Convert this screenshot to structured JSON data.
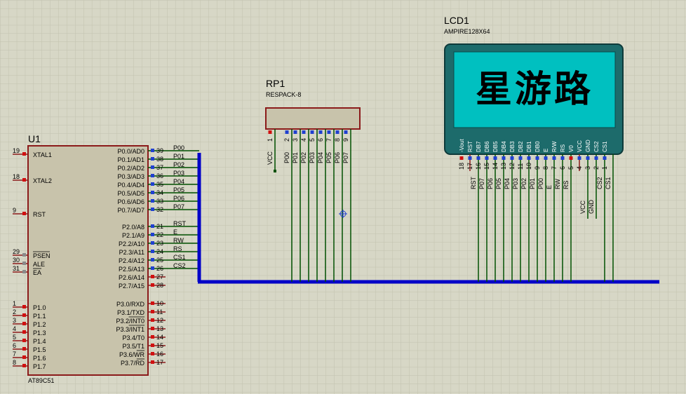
{
  "u1": {
    "ref": "U1",
    "part": "AT89C51",
    "left_pins": [
      {
        "num": "19",
        "name": "XTAL1"
      },
      {
        "num": "18",
        "name": "XTAL2"
      },
      {
        "num": "9",
        "name": "RST"
      },
      {
        "num": "29",
        "name": "PSEN"
      },
      {
        "num": "30",
        "name": "ALE"
      },
      {
        "num": "31",
        "name": "EA"
      },
      {
        "num": "1",
        "name": "P1.0"
      },
      {
        "num": "2",
        "name": "P1.1"
      },
      {
        "num": "3",
        "name": "P1.2"
      },
      {
        "num": "4",
        "name": "P1.3"
      },
      {
        "num": "5",
        "name": "P1.4"
      },
      {
        "num": "6",
        "name": "P1.5"
      },
      {
        "num": "7",
        "name": "P1.6"
      },
      {
        "num": "8",
        "name": "P1.7"
      }
    ],
    "right_pins": [
      {
        "num": "39",
        "name": "P0.0/AD0",
        "net": "P00"
      },
      {
        "num": "38",
        "name": "P0.1/AD1",
        "net": "P01"
      },
      {
        "num": "37",
        "name": "P0.2/AD2",
        "net": "P02"
      },
      {
        "num": "36",
        "name": "P0.3/AD3",
        "net": "P03"
      },
      {
        "num": "35",
        "name": "P0.4/AD4",
        "net": "P04"
      },
      {
        "num": "34",
        "name": "P0.5/AD5",
        "net": "P05"
      },
      {
        "num": "33",
        "name": "P0.6/AD6",
        "net": "P06"
      },
      {
        "num": "32",
        "name": "P0.7/AD7",
        "net": "P07"
      },
      {
        "num": "21",
        "name": "P2.0/A8",
        "net": "RST"
      },
      {
        "num": "22",
        "name": "P2.1/A9",
        "net": "E"
      },
      {
        "num": "23",
        "name": "P2.2/A10",
        "net": "RW"
      },
      {
        "num": "24",
        "name": "P2.3/A11",
        "net": "RS"
      },
      {
        "num": "25",
        "name": "P2.4/A12",
        "net": "CS1"
      },
      {
        "num": "26",
        "name": "P2.5/A13",
        "net": "CS2"
      },
      {
        "num": "27",
        "name": "P2.6/A14",
        "net": ""
      },
      {
        "num": "28",
        "name": "P2.7/A15",
        "net": ""
      },
      {
        "num": "10",
        "name": "P3.0/RXD",
        "net": ""
      },
      {
        "num": "11",
        "name": "P3.1/TXD",
        "net": ""
      },
      {
        "num": "12",
        "name": "P3.2/INT0",
        "net": ""
      },
      {
        "num": "13",
        "name": "P3.3/INT1",
        "net": ""
      },
      {
        "num": "14",
        "name": "P3.4/T0",
        "net": ""
      },
      {
        "num": "15",
        "name": "P3.5/T1",
        "net": ""
      },
      {
        "num": "16",
        "name": "P3.6/WR",
        "net": ""
      },
      {
        "num": "17",
        "name": "P3.7/RD",
        "net": ""
      }
    ]
  },
  "rp1": {
    "ref": "RP1",
    "part": "RESPACK-8",
    "pins": [
      {
        "num": "1",
        "net": "VCC"
      },
      {
        "num": "2",
        "net": "P00"
      },
      {
        "num": "3",
        "net": "P01"
      },
      {
        "num": "4",
        "net": "P02"
      },
      {
        "num": "5",
        "net": "P03"
      },
      {
        "num": "6",
        "net": "P04"
      },
      {
        "num": "7",
        "net": "P05"
      },
      {
        "num": "8",
        "net": "P06"
      },
      {
        "num": "9",
        "net": "P07"
      }
    ]
  },
  "lcd1": {
    "ref": "LCD1",
    "part": "AMPIRE128X64",
    "display_text": "星游路",
    "pins": [
      {
        "num": "18",
        "name": "-Vout",
        "net": ""
      },
      {
        "num": "17",
        "name": "RST",
        "net": "RST"
      },
      {
        "num": "16",
        "name": "DB7",
        "net": "P07"
      },
      {
        "num": "15",
        "name": "DB6",
        "net": "P06"
      },
      {
        "num": "14",
        "name": "DB5",
        "net": "P05"
      },
      {
        "num": "13",
        "name": "DB4",
        "net": "P04"
      },
      {
        "num": "12",
        "name": "DB3",
        "net": "P03"
      },
      {
        "num": "11",
        "name": "DB2",
        "net": "P02"
      },
      {
        "num": "10",
        "name": "DB1",
        "net": "P01"
      },
      {
        "num": "9",
        "name": "DB0",
        "net": "P00"
      },
      {
        "num": "8",
        "name": "E",
        "net": "E"
      },
      {
        "num": "7",
        "name": "R/W",
        "net": "RW"
      },
      {
        "num": "6",
        "name": "RS",
        "net": "RS"
      },
      {
        "num": "5",
        "name": "V0",
        "net": ""
      },
      {
        "num": "4",
        "name": "VCC",
        "net": "VCC"
      },
      {
        "num": "3",
        "name": "GND",
        "net": "GND"
      },
      {
        "num": "2",
        "name": "CS2",
        "net": "CS2"
      },
      {
        "num": "1",
        "name": "CS1",
        "net": "CS1"
      }
    ]
  },
  "colors": {
    "background": "#d7d7c6",
    "grid": "#c3c3b0",
    "component_outline": "#8b1a1a",
    "component_fill": "#c8c3ab",
    "wire": "#005000",
    "bus": "#0000c8",
    "pin_text": "#000000",
    "lcd_body": "#1d6b6b",
    "lcd_screen": "#00c0c0",
    "pin_marker_red": "#d01010",
    "pin_marker_blue": "#2040d0"
  }
}
